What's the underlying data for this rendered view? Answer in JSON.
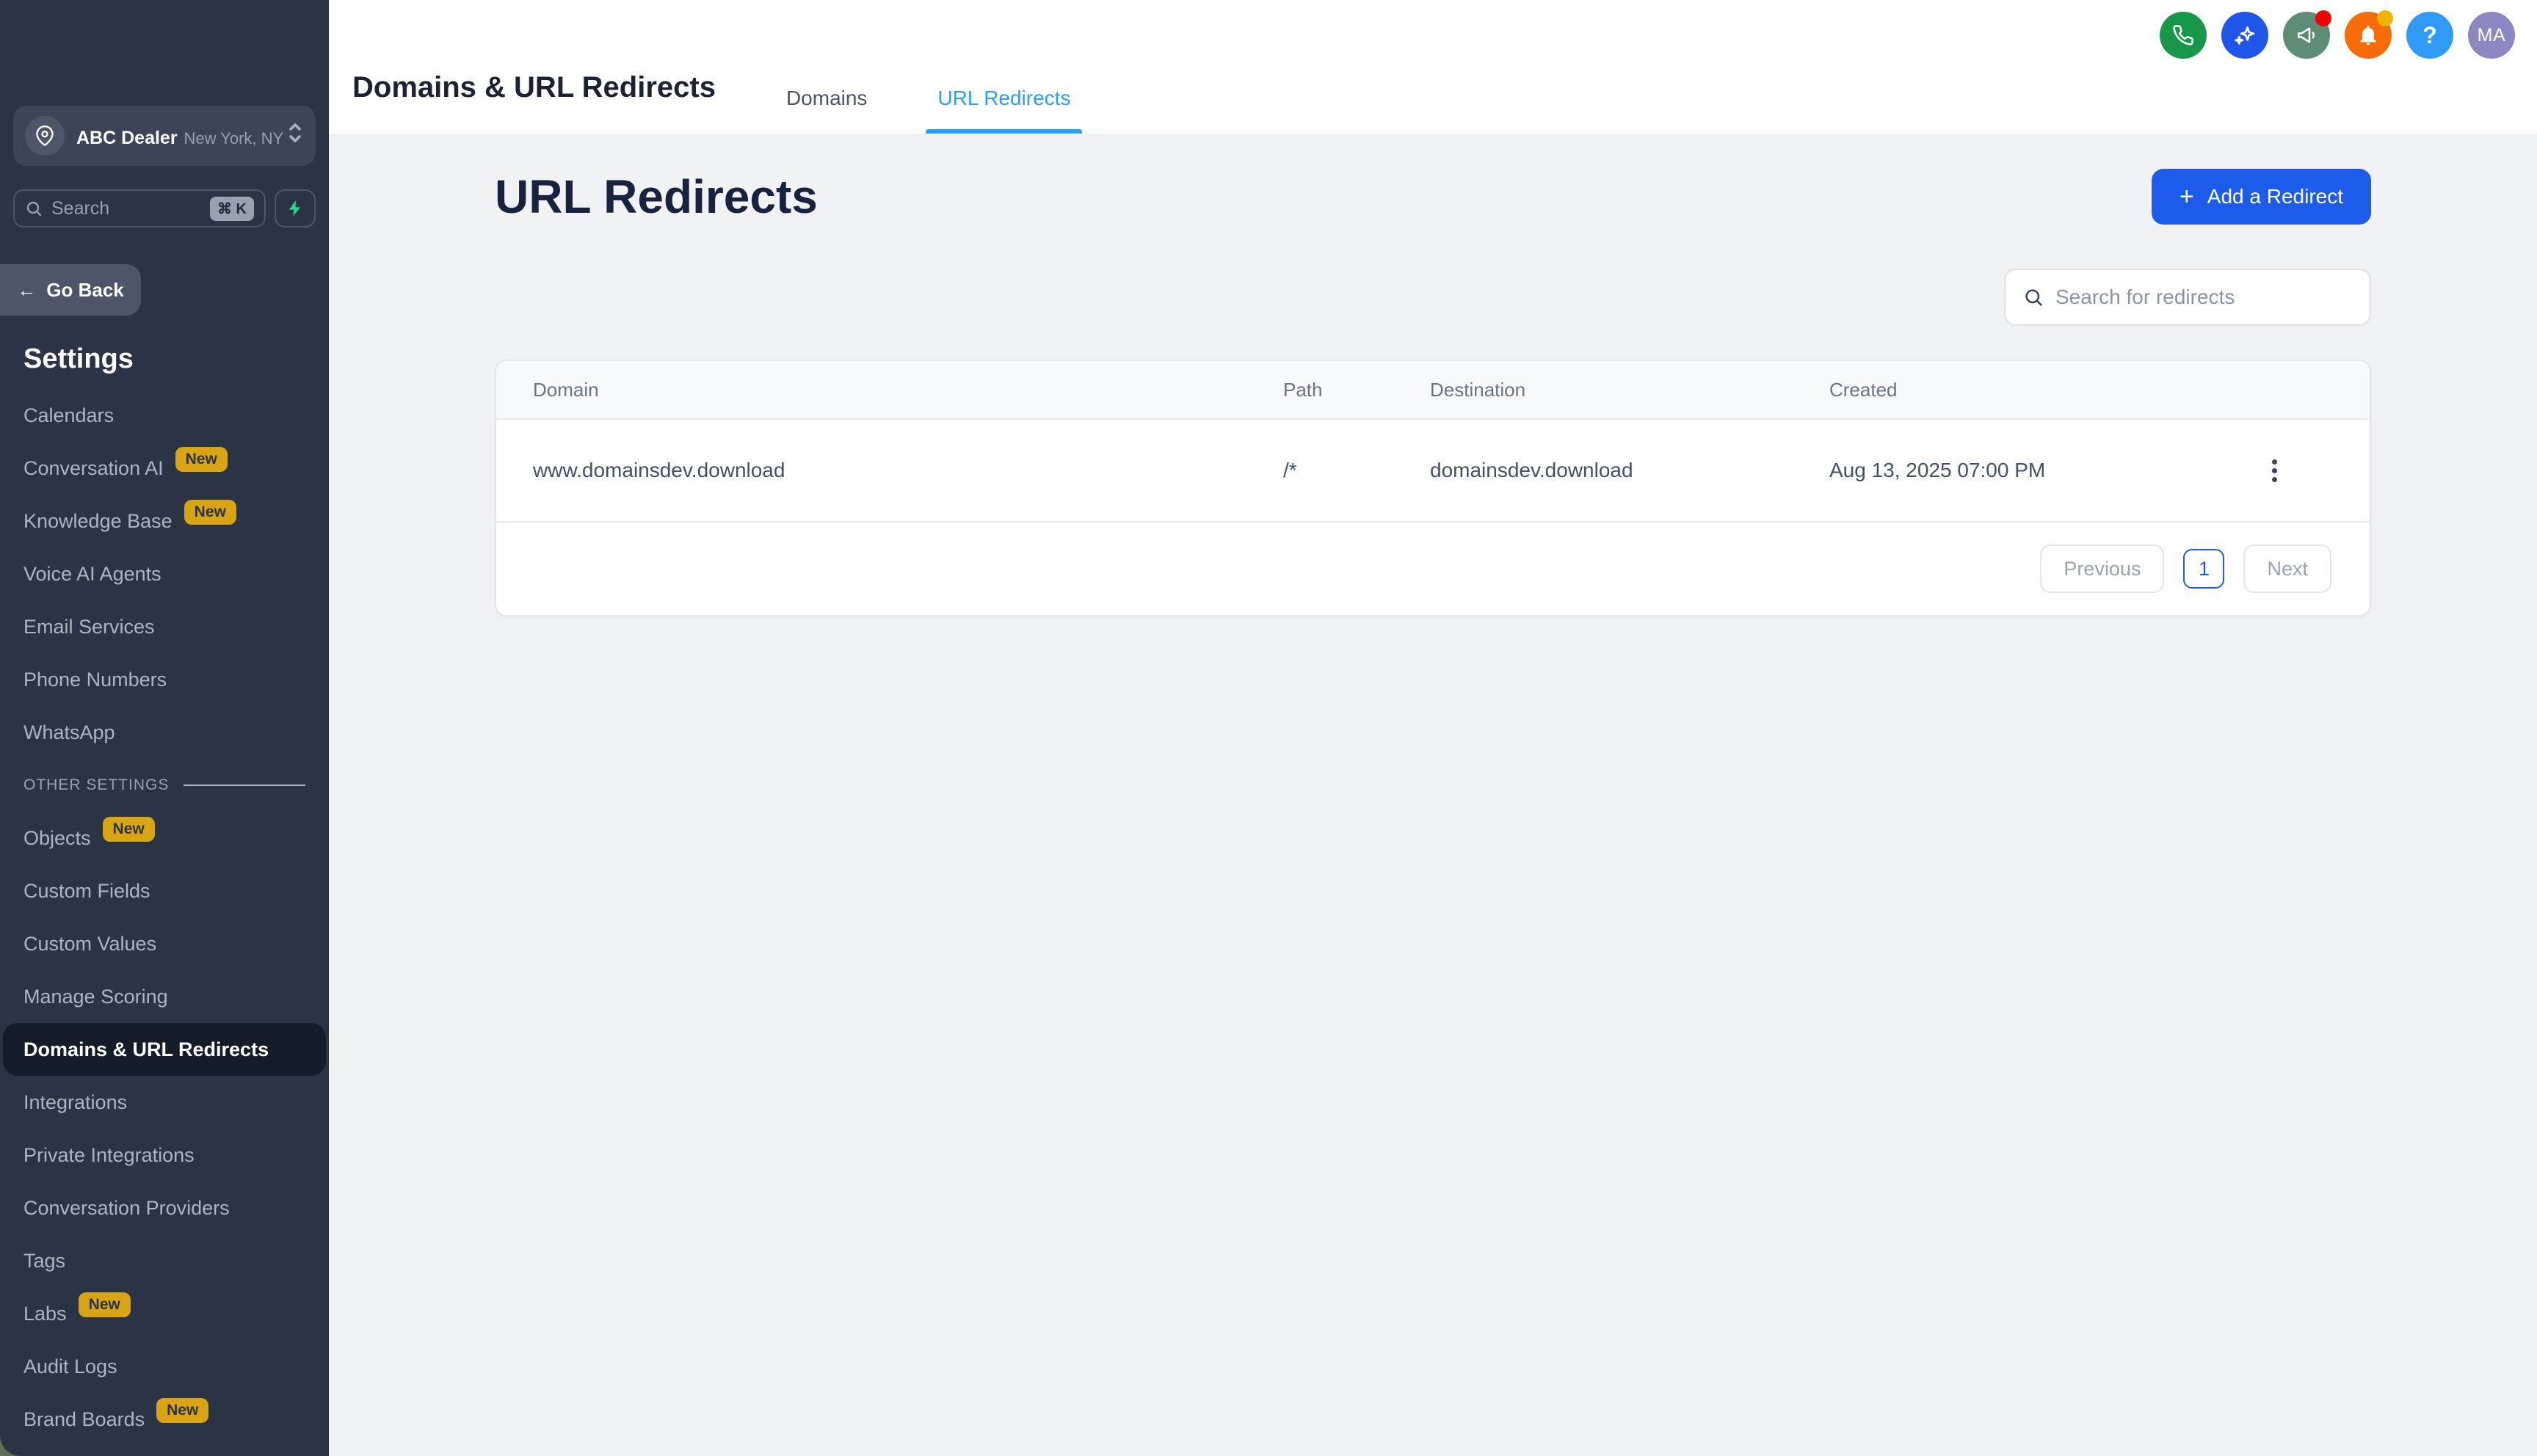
{
  "colors": {
    "accent_blue": "#1d5ceb",
    "tab_blue": "#2b9ff7",
    "sidebar_bg": "#2b3444",
    "active_item_bg": "#151c29",
    "badge_bg": "#d9a514",
    "phone_green": "#179848",
    "ai_blue": "#2056e8",
    "announce_green": "#5d8d74",
    "bell_orange": "#f86c07",
    "help_blue": "#2f9bf6",
    "avatar_purple": "#8e88c2"
  },
  "sidebar": {
    "account": {
      "name": "ABC Dealer",
      "location": "New York, NY"
    },
    "search": {
      "placeholder": "Search",
      "shortcut": "⌘ K"
    },
    "go_back_label": "Go Back",
    "settings_heading": "Settings",
    "items": [
      {
        "label": "Calendars"
      },
      {
        "label": "Conversation AI",
        "badge": "New"
      },
      {
        "label": "Knowledge Base",
        "badge": "New"
      },
      {
        "label": "Voice AI Agents"
      },
      {
        "label": "Email Services"
      },
      {
        "label": "Phone Numbers"
      },
      {
        "label": "WhatsApp"
      },
      {
        "label": "OTHER SETTINGS",
        "type": "section"
      },
      {
        "label": "Objects",
        "badge": "New"
      },
      {
        "label": "Custom Fields"
      },
      {
        "label": "Custom Values"
      },
      {
        "label": "Manage Scoring"
      },
      {
        "label": "Domains & URL Redirects",
        "active": true
      },
      {
        "label": "Integrations"
      },
      {
        "label": "Private Integrations"
      },
      {
        "label": "Conversation Providers"
      },
      {
        "label": "Tags"
      },
      {
        "label": "Labs",
        "badge": "New"
      },
      {
        "label": "Audit Logs"
      },
      {
        "label": "Brand Boards",
        "badge": "New"
      }
    ]
  },
  "topbar": {
    "title": "Domains & URL Redirects",
    "tabs": [
      {
        "label": "Domains",
        "active": false
      },
      {
        "label": "URL Redirects",
        "active": true
      }
    ],
    "icons": [
      "phone-icon",
      "ai-sparkles-icon",
      "megaphone-icon",
      "bell-icon",
      "help-icon"
    ],
    "avatar_initials": "MA"
  },
  "main": {
    "heading": "URL Redirects",
    "add_button_label": "Add a Redirect",
    "add_button_plus": "+",
    "search_placeholder": "Search for redirects",
    "table": {
      "columns": [
        "Domain",
        "Path",
        "Destination",
        "Created"
      ],
      "rows": [
        {
          "domain": "www.domainsdev.download",
          "path": "/*",
          "destination": "domainsdev.download",
          "created": "Aug 13, 2025 07:00 PM"
        }
      ]
    },
    "pagination": {
      "previous": "Previous",
      "page": "1",
      "next": "Next"
    }
  }
}
